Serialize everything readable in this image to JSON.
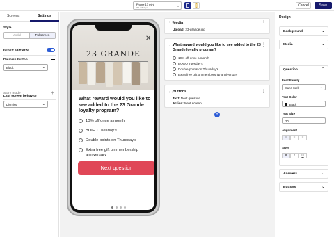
{
  "topbar": {
    "device_name": "iPhone 13 mini",
    "device_dims": "375 × 812 px",
    "cancel_label": "Cancel",
    "save_label": "Save",
    "accent": "#15196b"
  },
  "left_panel": {
    "tabs": [
      {
        "label": "Screens"
      },
      {
        "label": "Settings"
      }
    ],
    "style_label": "Style",
    "style_options": [
      "Modal",
      "Fullscreen"
    ],
    "ignore_safe_area_label": "Ignore safe area",
    "dismiss_button_label": "Dismiss button",
    "dismiss_button_value": "Black",
    "story_mode_label": "Story mode",
    "last_screen_behavior_label": "Last screen behavior",
    "last_screen_behavior_value": "Dismiss"
  },
  "preview": {
    "brand": "23 GRANDE",
    "question": "What reward would you like to see added to the 23 Grande loyalty program?",
    "options": [
      "10% off once a month",
      "BOGO Tuesday's",
      "Double points on Thursday's",
      "Extra free gift on membership anniversary"
    ],
    "next_label": "Next  question",
    "next_color": "#e04757"
  },
  "cards": {
    "media": {
      "title": "Media",
      "upload_key": "Upload:",
      "upload_val": "23-grande.jpg"
    },
    "question": {
      "title": "What reward would you like to see added to the 23 Grande loyalty program?",
      "options": [
        "10% off once a month",
        "BOGO Tuesday's",
        "Double points on Thursday's",
        "Extra free gift on membership anniversary"
      ]
    },
    "buttons": {
      "title": "Buttons",
      "text_key": "Text:",
      "text_val": "Next question",
      "action_key": "Action:",
      "action_val": "Next screen"
    }
  },
  "design": {
    "title": "Design",
    "sections_top": [
      "Background",
      "Media"
    ],
    "question_section": "Question",
    "font_family_label": "Font Family",
    "font_family_value": "Sans-Serif",
    "text_color_label": "Text Color",
    "text_color_value": "Black",
    "text_size_label": "Text Size",
    "text_size_value": "20",
    "alignment_label": "Alignment",
    "style_label": "Style",
    "style_buttons": [
      "B",
      "I",
      "U"
    ],
    "sections_bottom": [
      "Answers",
      "Buttons"
    ]
  }
}
